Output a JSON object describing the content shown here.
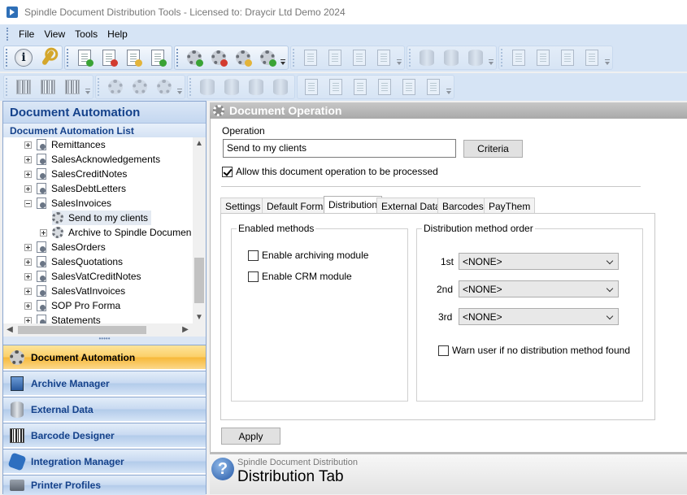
{
  "window": {
    "title": "Spindle Document Distribution Tools - Licensed to: Draycir Ltd Demo 2024"
  },
  "menu": [
    "File",
    "View",
    "Tools",
    "Help"
  ],
  "left_panel": {
    "header": "Document Automation",
    "subheader": "Document Automation List",
    "tree": [
      {
        "label": "Remittances"
      },
      {
        "label": "SalesAcknowledgements"
      },
      {
        "label": "SalesCreditNotes"
      },
      {
        "label": "SalesDebtLetters"
      },
      {
        "label": "SalesInvoices"
      },
      {
        "label": "Send to my clients"
      },
      {
        "label": "Archive to Spindle Documen"
      },
      {
        "label": "SalesOrders"
      },
      {
        "label": "SalesQuotations"
      },
      {
        "label": "SalesVatCreditNotes"
      },
      {
        "label": "SalesVatInvoices"
      },
      {
        "label": "SOP Pro Forma"
      },
      {
        "label": "Statements"
      }
    ],
    "nav": [
      {
        "label": "Document Automation",
        "icon": "gear-icon"
      },
      {
        "label": "Archive Manager",
        "icon": "archive-icon"
      },
      {
        "label": "External Data",
        "icon": "database-icon"
      },
      {
        "label": "Barcode Designer",
        "icon": "barcode-icon"
      },
      {
        "label": "Integration Manager",
        "icon": "puzzle-icon"
      },
      {
        "label": "Printer Profiles",
        "icon": "printer-icon"
      }
    ]
  },
  "right_panel": {
    "header": "Document Operation",
    "operation_label": "Operation",
    "operation_value": "Send to my clients",
    "criteria_button": "Criteria",
    "allow_label": "Allow this document operation to be processed",
    "allow_checked": true,
    "tabs": [
      "Settings",
      "Default Forms",
      "Distribution",
      "External Data",
      "Barcodes",
      "PayThem"
    ],
    "active_tab": "Distribution",
    "enabled_methods": {
      "title": "Enabled methods",
      "archiving": "Enable archiving module",
      "crm": "Enable CRM module"
    },
    "order": {
      "title": "Distribution method order",
      "rows": [
        {
          "label": "1st",
          "value": "<NONE>"
        },
        {
          "label": "2nd",
          "value": "<NONE>"
        },
        {
          "label": "3rd",
          "value": "<NONE>"
        }
      ],
      "warn_label": "Warn user if no distribution method found"
    },
    "apply_button": "Apply"
  },
  "help": {
    "source": "Spindle Document Distribution",
    "title": "Distribution Tab"
  },
  "colors": {
    "accent": "#15428b",
    "active_nav": "#f7b93a",
    "header_gray": "#a9a9a9"
  }
}
